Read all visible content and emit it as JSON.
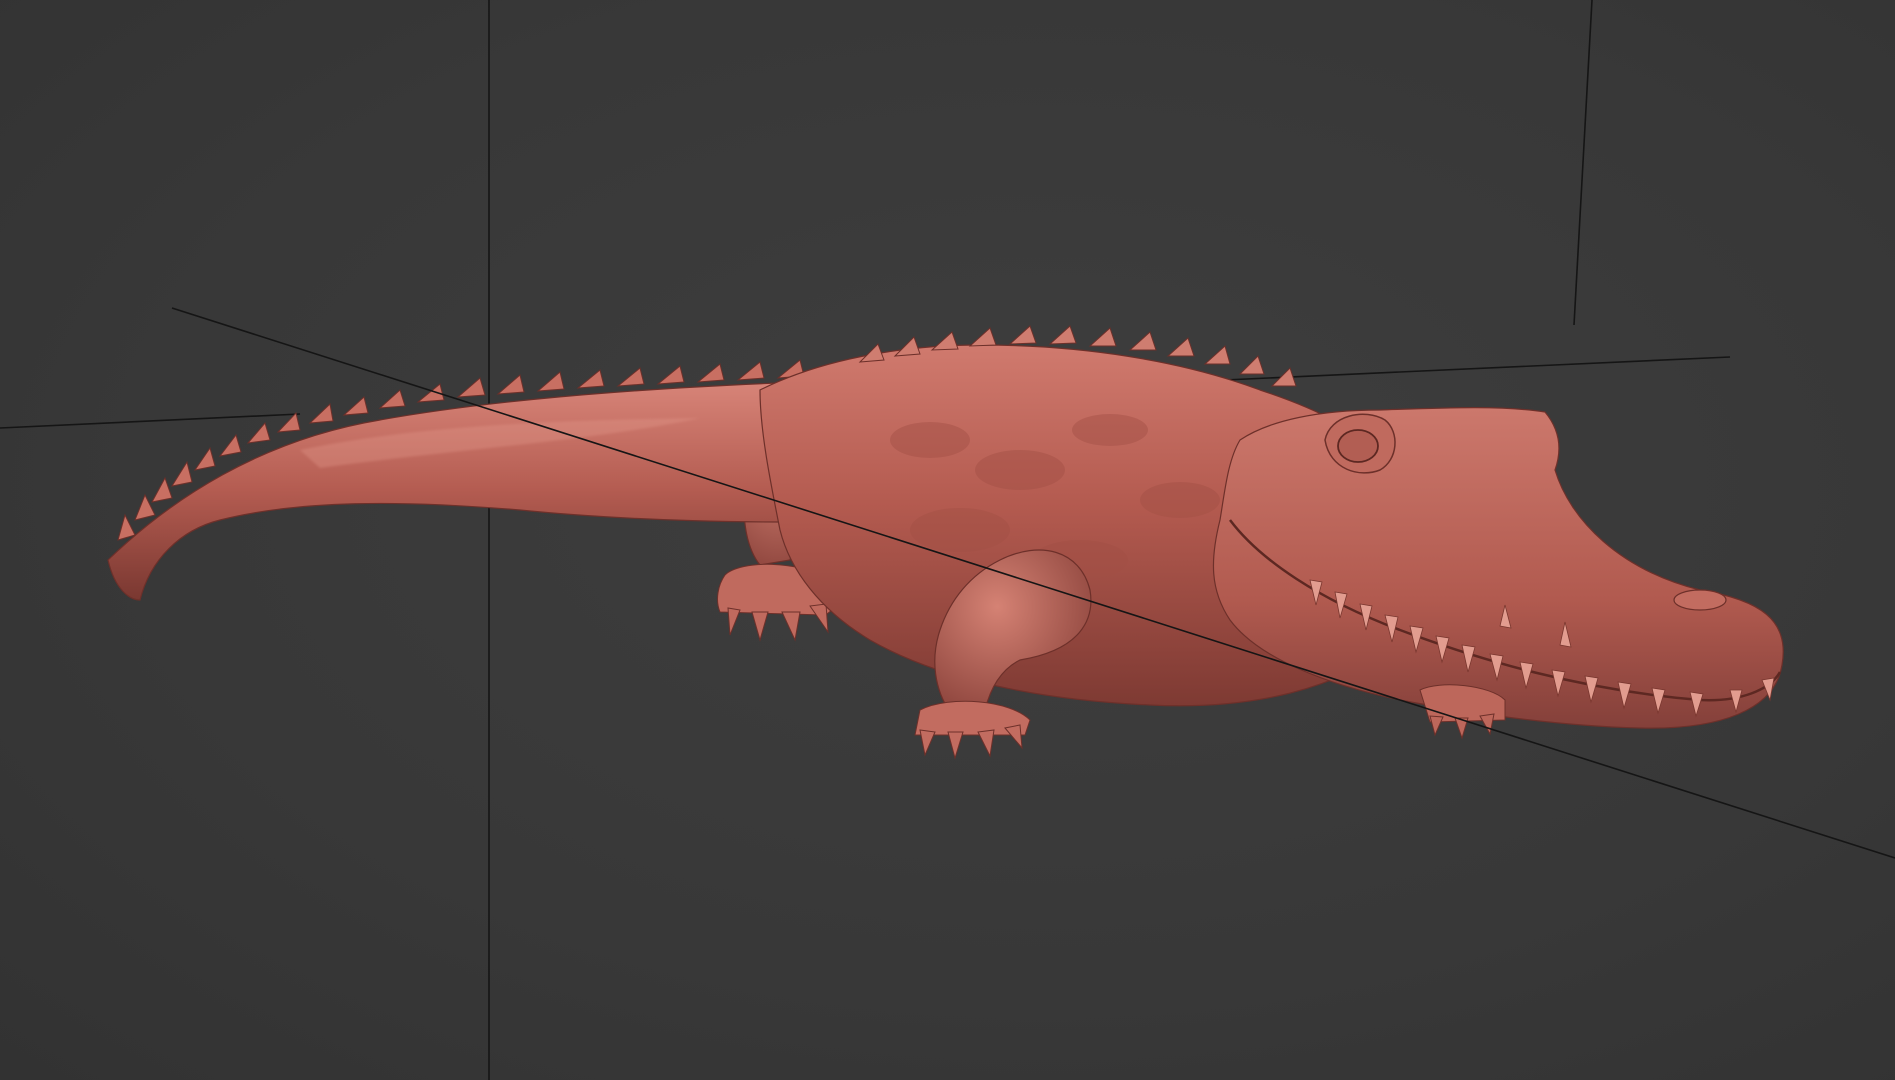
{
  "viewport": {
    "background_color": "#383838",
    "model": {
      "name": "crocodile",
      "material_color": "#b85a50"
    },
    "guides": {
      "line_color": "#111111"
    }
  }
}
